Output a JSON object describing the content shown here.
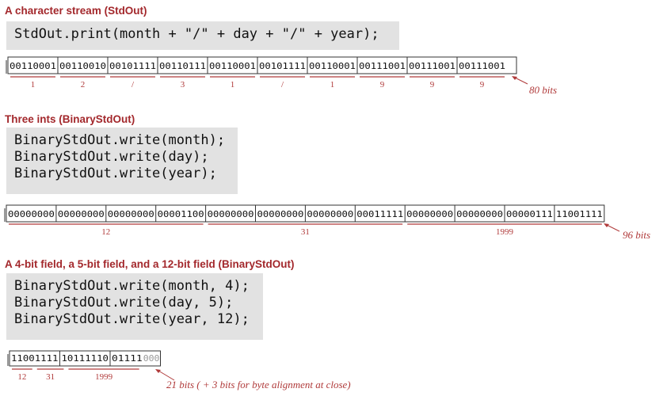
{
  "sections": [
    {
      "heading": "A character stream (StdOut)",
      "code": [
        "StdOut.print(month + \"/\" + day + \"/\" + year);"
      ],
      "cells": [
        "00110001",
        "00110010",
        "00101111",
        "00110111",
        "00110001",
        "00101111",
        "00110001",
        "00111001",
        "00111001",
        "00111001"
      ],
      "labels": [
        "1",
        "2",
        "/",
        "3",
        "1",
        "/",
        "1",
        "9",
        "9",
        "9"
      ],
      "total": "80 bits"
    },
    {
      "heading": "Three ints (BinaryStdOut)",
      "code": [
        "BinaryStdOut.write(month);",
        "BinaryStdOut.write(day);",
        "BinaryStdOut.write(year);"
      ],
      "cells": [
        "00000000",
        "00000000",
        "00000000",
        "00001100",
        "00000000",
        "00000000",
        "00000000",
        "00011111",
        "00000000",
        "00000000",
        "00000111",
        "11001111"
      ],
      "labels": [
        "12",
        "31",
        "1999"
      ],
      "total": "96 bits"
    },
    {
      "heading": "A 4-bit field, a 5-bit field, and a 12-bit field (BinaryStdOut)",
      "code": [
        "BinaryStdOut.write(month, 4);",
        "BinaryStdOut.write(day, 5);",
        "BinaryStdOut.write(year, 12);"
      ],
      "cells": [
        "11001111",
        "10111110",
        "01111000"
      ],
      "padding_bits": "000",
      "labels": [
        "12",
        "31",
        "1999"
      ],
      "total": "21 bits ( + 3 bits for byte alignment at close)"
    }
  ],
  "colors": {
    "heading": "#a3282c",
    "underline": "#b03a3a",
    "code_bg": "#e2e2e2",
    "padding": "#9a9a9a"
  }
}
